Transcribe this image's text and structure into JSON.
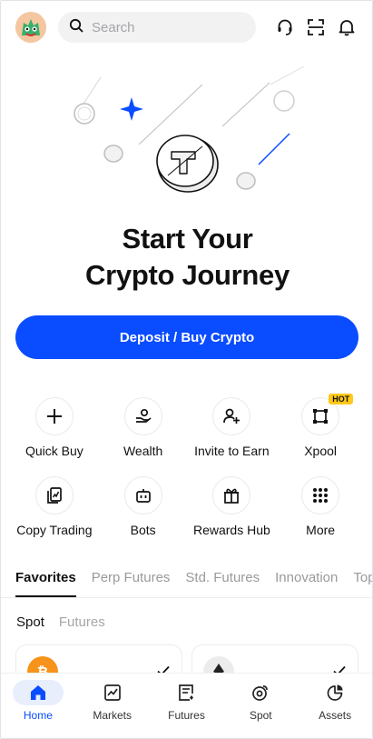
{
  "search": {
    "placeholder": "Search"
  },
  "hero": {
    "title_line1": "Start Your",
    "title_line2": "Crypto Journey",
    "cta_label": "Deposit / Buy Crypto"
  },
  "shortcuts": [
    {
      "label": "Quick Buy",
      "icon": "plus-icon"
    },
    {
      "label": "Wealth",
      "icon": "hand-coin-icon"
    },
    {
      "label": "Invite to Earn",
      "icon": "add-user-icon"
    },
    {
      "label": "Xpool",
      "icon": "xpool-icon",
      "badge": "HOT"
    },
    {
      "label": "Copy Trading",
      "icon": "copy-trading-icon"
    },
    {
      "label": "Bots",
      "icon": "bot-icon"
    },
    {
      "label": "Rewards Hub",
      "icon": "gift-icon"
    },
    {
      "label": "More",
      "icon": "grid-dots-icon"
    }
  ],
  "tabs": [
    {
      "label": "Favorites",
      "active": true
    },
    {
      "label": "Perp Futures"
    },
    {
      "label": "Std. Futures"
    },
    {
      "label": "Innovation"
    },
    {
      "label": "Top"
    }
  ],
  "subtabs": [
    {
      "label": "Spot",
      "active": true
    },
    {
      "label": "Futures"
    }
  ],
  "cards": [
    {
      "coin_icon": "bitcoin-icon",
      "checked": true
    },
    {
      "coin_icon": "ethereum-icon",
      "checked": true
    }
  ],
  "bottom_nav": [
    {
      "label": "Home",
      "icon": "home-icon",
      "active": true
    },
    {
      "label": "Markets",
      "icon": "markets-icon"
    },
    {
      "label": "Futures",
      "icon": "futures-icon"
    },
    {
      "label": "Spot",
      "icon": "spot-icon"
    },
    {
      "label": "Assets",
      "icon": "assets-icon"
    }
  ],
  "colors": {
    "accent": "#0a4cff",
    "hot_badge": "#ffc81a",
    "bitcoin": "#f7931a"
  }
}
